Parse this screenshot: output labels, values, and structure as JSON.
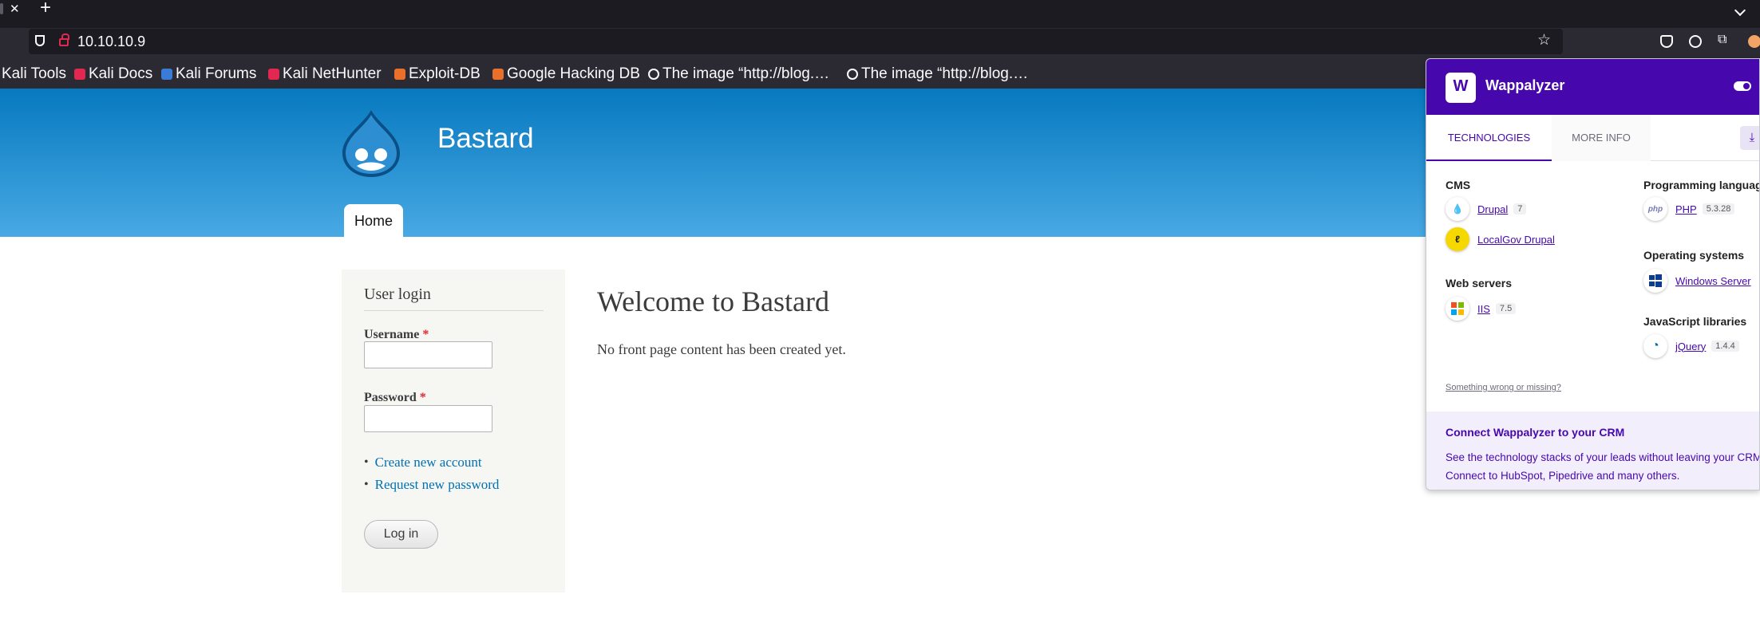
{
  "browser": {
    "url": "10.10.10.9",
    "bookmarks": [
      {
        "label": "Kali Tools",
        "icon": "kali-icon",
        "color": "#2b2a33"
      },
      {
        "label": "Kali Docs",
        "icon": "kali-docs-icon",
        "color": "#e22850"
      },
      {
        "label": "Kali Forums",
        "icon": "kali-forums-icon",
        "color": "#3a7bd5"
      },
      {
        "label": "Kali NetHunter",
        "icon": "nethunter-icon",
        "color": "#e22850"
      },
      {
        "label": "Exploit-DB",
        "icon": "exploitdb-icon",
        "color": "#e8702a"
      },
      {
        "label": "Google Hacking DB",
        "icon": "ghdb-icon",
        "color": "#e8702a"
      },
      {
        "label": "The image “http://blog.…",
        "icon": "globe-icon",
        "color": "#fbfbfe"
      },
      {
        "label": "The image “http://blog.…",
        "icon": "globe-icon",
        "color": "#fbfbfe"
      }
    ]
  },
  "site": {
    "name": "Bastard",
    "nav": {
      "home": "Home"
    },
    "login": {
      "title": "User login",
      "username_label": "Username",
      "password_label": "Password",
      "required_marker": "*",
      "links": [
        "Create new account",
        "Request new password"
      ],
      "submit": "Log in"
    },
    "main": {
      "title": "Welcome to Bastard",
      "body": "No front page content has been created yet."
    }
  },
  "wappalyzer": {
    "title": "Wappalyzer",
    "tabs": {
      "technologies": "TECHNOLOGIES",
      "more_info": "MORE INFO"
    },
    "categories": {
      "cms": {
        "label": "CMS",
        "items": [
          {
            "name": "Drupal",
            "version": "7",
            "icon": "drupal-icon"
          },
          {
            "name": "LocalGov Drupal",
            "version": "",
            "icon": "localgov-icon"
          }
        ]
      },
      "web_servers": {
        "label": "Web servers",
        "items": [
          {
            "name": "IIS",
            "version": "7.5",
            "icon": "windows-icon"
          }
        ]
      },
      "programming": {
        "label": "Programming languag",
        "items": [
          {
            "name": "PHP",
            "version": "5.3.28",
            "icon": "php-icon"
          }
        ]
      },
      "os": {
        "label": "Operating systems",
        "items": [
          {
            "name": "Windows Server",
            "version": "",
            "icon": "windows-server-icon"
          }
        ]
      },
      "js": {
        "label": "JavaScript libraries",
        "items": [
          {
            "name": "jQuery",
            "version": "1.4.4",
            "icon": "jquery-icon"
          }
        ]
      }
    },
    "wrong": "Something wrong or missing?",
    "crm": {
      "title": "Connect Wappalyzer to your CRM",
      "text": "See the technology stacks of your leads without leaving your CRM. Connect to HubSpot, Pipedrive and many others."
    },
    "colors": {
      "brand": "#4608ad",
      "drupal": "#0678be",
      "php": "#777bb3",
      "jquery": "#0769ad"
    }
  }
}
